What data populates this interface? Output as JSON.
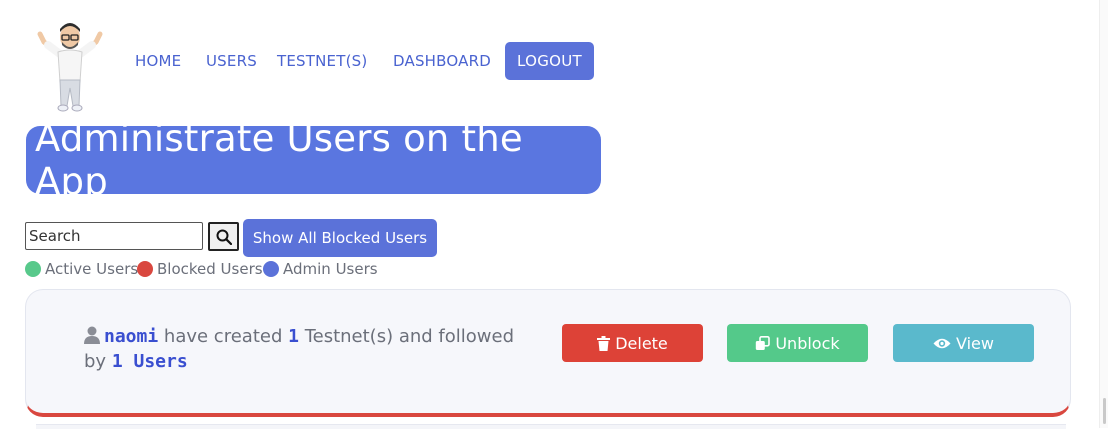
{
  "nav": {
    "items": [
      {
        "label": "HOME"
      },
      {
        "label": "USERS"
      },
      {
        "label": "TESTNET(S)"
      },
      {
        "label": "DASHBOARD"
      }
    ],
    "logout_label": "LOGOUT"
  },
  "page": {
    "title": "Administrate Users on the App"
  },
  "search": {
    "placeholder": "Search",
    "show_blocked_label": "Show All Blocked Users"
  },
  "legend": [
    {
      "label": "Active Users",
      "color": "#58c98b"
    },
    {
      "label": "Blocked Users",
      "color": "#d9473f"
    },
    {
      "label": "Admin Users",
      "color": "#5b72d9"
    }
  ],
  "users": [
    {
      "username": "naomi",
      "text_created": "have created",
      "testnet_count": "1",
      "text_testnets": "Testnet(s) and followed",
      "text_by": "by",
      "followed_count": "1 Users",
      "status_color": "#d9473f",
      "actions": {
        "delete": "Delete",
        "unblock": "Unblock",
        "view": "View"
      }
    }
  ]
}
